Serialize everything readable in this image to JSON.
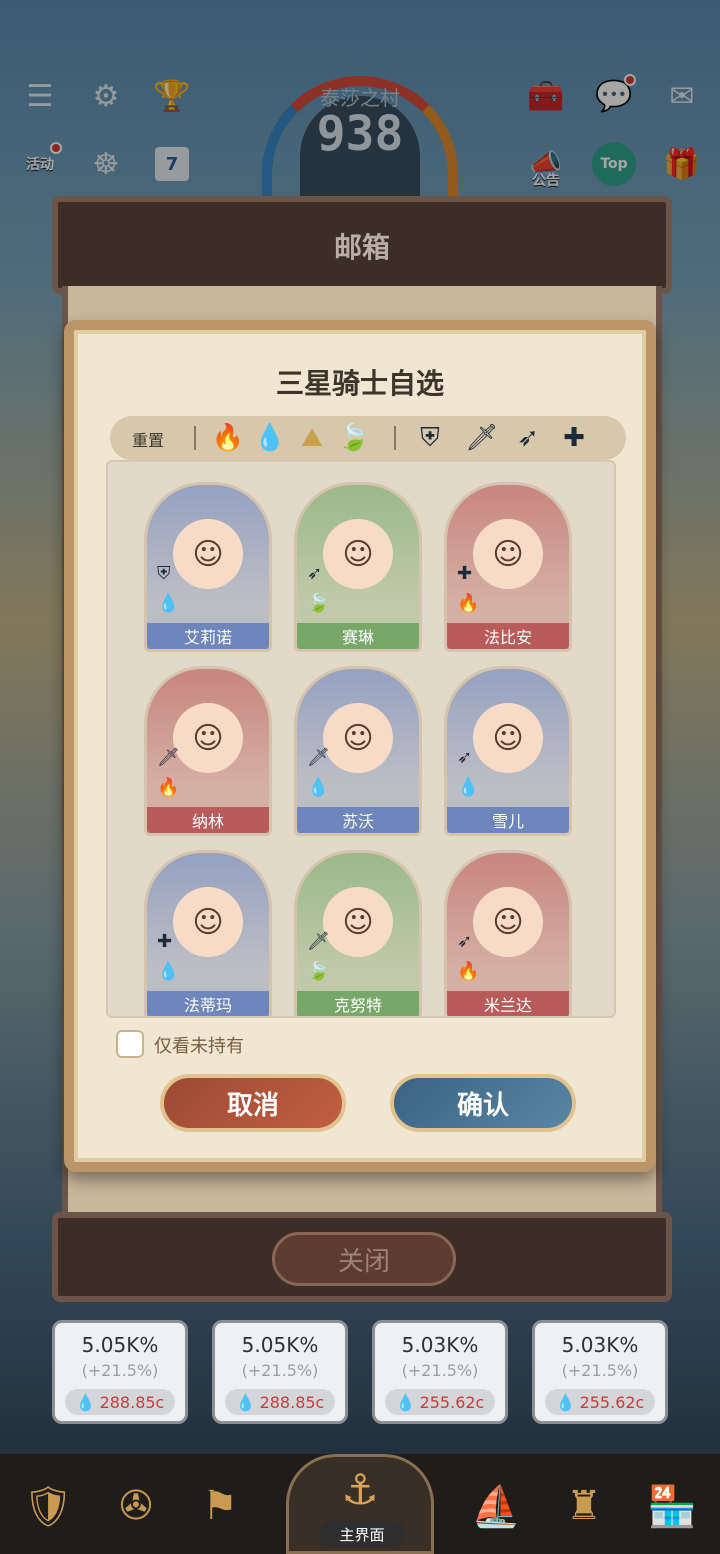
{
  "hud": {
    "village_name": "泰莎之村",
    "village_score": "938",
    "calendar_day": "7",
    "activity_label": "活动",
    "notice_label": "公告",
    "top_label": "Top"
  },
  "mailbox": {
    "title": "邮箱",
    "close_label": "关闭"
  },
  "dialog": {
    "title": "三星骑士自选",
    "reset_label": "重置",
    "only_unowned_label": "仅看未持有",
    "cancel_label": "取消",
    "confirm_label": "确认"
  },
  "knights": [
    {
      "name": "艾莉诺",
      "bg": "#6f86bd",
      "role": "⛨",
      "element": "💧"
    },
    {
      "name": "赛琳",
      "bg": "#77a86a",
      "role": "➶",
      "element": "🍃"
    },
    {
      "name": "法比安",
      "bg": "#b95b5b",
      "role": "✚",
      "element": "🔥"
    },
    {
      "name": "纳林",
      "bg": "#b95b5b",
      "role": "🗡",
      "element": "🔥"
    },
    {
      "name": "苏沃",
      "bg": "#6f86bd",
      "role": "🗡",
      "element": "💧"
    },
    {
      "name": "雪儿",
      "bg": "#6f86bd",
      "role": "➶",
      "element": "💧"
    },
    {
      "name": "法蒂玛",
      "bg": "#6f86bd",
      "role": "✚",
      "element": "💧"
    },
    {
      "name": "克努特",
      "bg": "#77a86a",
      "role": "🗡",
      "element": "🍃"
    },
    {
      "name": "米兰达",
      "bg": "#b95b5b",
      "role": "➶",
      "element": "🔥"
    }
  ],
  "stats": [
    {
      "value": "5.05K%",
      "delta": "(+21.5%)",
      "cost": "288.85c"
    },
    {
      "value": "5.05K%",
      "delta": "(+21.5%)",
      "cost": "288.85c"
    },
    {
      "value": "5.03K%",
      "delta": "(+21.5%)",
      "cost": "255.62c"
    },
    {
      "value": "5.03K%",
      "delta": "(+21.5%)",
      "cost": "255.62c"
    }
  ],
  "nav": {
    "main_label": "主界面"
  }
}
